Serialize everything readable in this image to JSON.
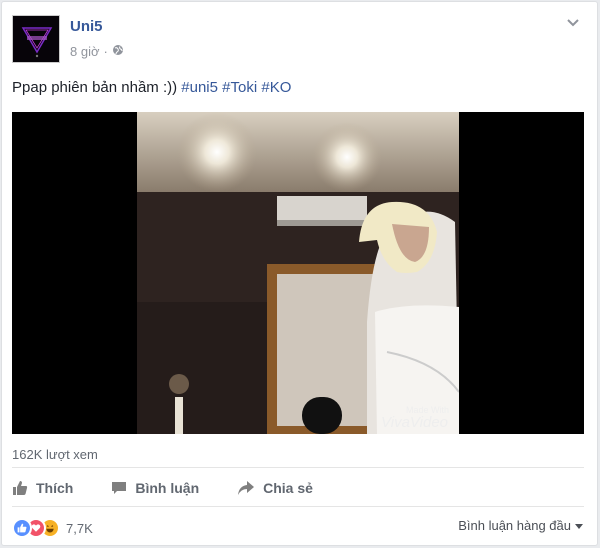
{
  "post": {
    "author": "Uni5",
    "time": "8 giờ",
    "caption_text": "Ppap phiên bản nhầm :)) ",
    "hashtags": [
      "#uni5",
      "#Toki",
      "#KO"
    ]
  },
  "video": {
    "watermark_line1": "Made With",
    "watermark_line2": "VivaVideo"
  },
  "stats": {
    "views": "162K lượt xem"
  },
  "actions": {
    "like": "Thích",
    "comment": "Bình luận",
    "share": "Chia sẻ"
  },
  "reactions": {
    "count": "7,7K",
    "types": [
      "like-icon",
      "love-icon",
      "haha-icon"
    ]
  },
  "comments": {
    "sort_label": "Bình luận hàng đầu"
  },
  "colors": {
    "link": "#365899",
    "like": "#5890ff",
    "love": "#f25268",
    "haha": "#f7b125"
  }
}
